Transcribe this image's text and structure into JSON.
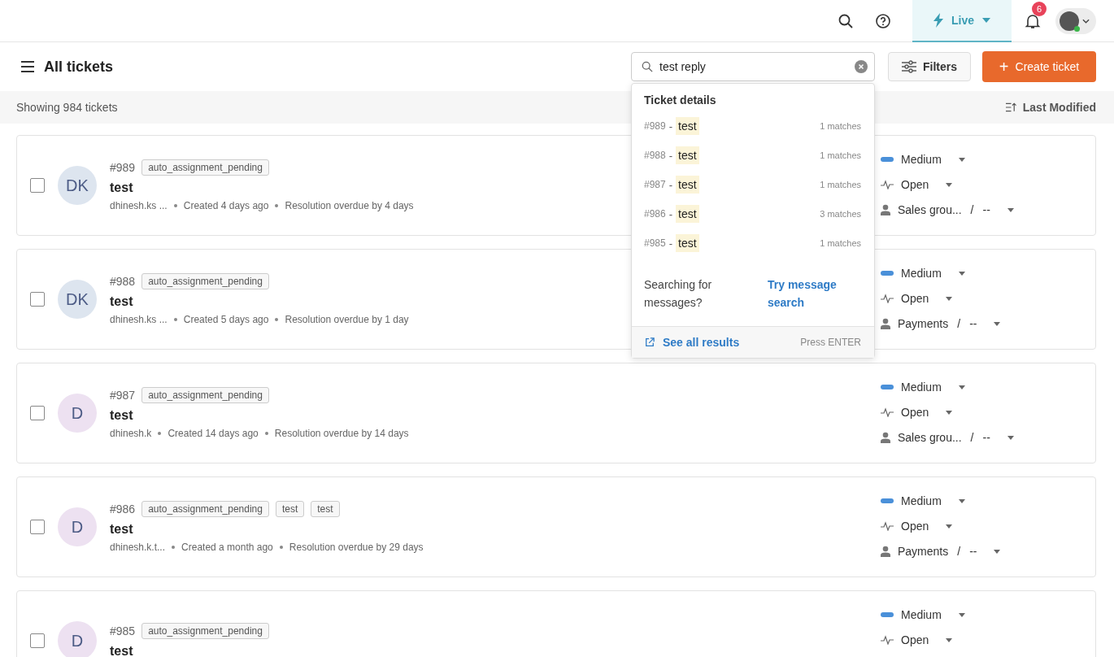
{
  "topbar": {
    "live_label": "Live",
    "notification_count": "6"
  },
  "header": {
    "title": "All tickets",
    "search": {
      "value": "test reply"
    },
    "filters_label": "Filters",
    "create_label": "Create ticket",
    "create_icon": "+"
  },
  "subbar": {
    "count": "Showing 984 tickets",
    "sort_label": "Last Modified"
  },
  "tickets": [
    {
      "id": "#989",
      "tags": [
        "auto_assignment_pending"
      ],
      "subject": "test",
      "initials": "DK",
      "color": "#dde5ef",
      "meta": [
        "dhinesh.ks ...",
        "Created 4 days ago",
        "Resolution overdue by 4 days"
      ],
      "priority": "Medium",
      "status": "Open",
      "team": "Sales grou...",
      "separator": "/",
      "agent": "--",
      "checked": false
    },
    {
      "id": "#988",
      "tags": [
        "auto_assignment_pending"
      ],
      "subject": "test",
      "initials": "DK",
      "color": "#dde5ef",
      "meta": [
        "dhinesh.ks ...",
        "Created 5 days ago",
        "Resolution overdue by 1 day"
      ],
      "priority": "Medium",
      "status": "Open",
      "team": "Payments",
      "separator": "/",
      "agent": "--",
      "checked": false
    },
    {
      "id": "#987",
      "tags": [
        "auto_assignment_pending"
      ],
      "subject": "test",
      "initials": "D",
      "color": "#ede1f1",
      "meta": [
        "dhinesh.k",
        "Created 14 days ago",
        "Resolution overdue by 14 days"
      ],
      "priority": "Medium",
      "status": "Open",
      "team": "Sales grou...",
      "separator": "/",
      "agent": "--",
      "checked": false
    },
    {
      "id": "#986",
      "tags": [
        "auto_assignment_pending",
        "test",
        "test"
      ],
      "subject": "test",
      "initials": "D",
      "color": "#ede1f1",
      "meta": [
        "dhinesh.k.t...",
        "Created a month ago",
        "Resolution overdue by 29 days"
      ],
      "priority": "Medium",
      "status": "Open",
      "team": "Payments",
      "separator": "/",
      "agent": "--",
      "checked": false
    },
    {
      "id": "#985",
      "tags": [
        "auto_assignment_pending"
      ],
      "subject": "test",
      "initials": "D",
      "color": "#ede1f1",
      "priority": "Medium",
      "status": "Open",
      "checked": false
    }
  ],
  "search_dropdown": {
    "heading": "Ticket details",
    "results": [
      {
        "id": "#989",
        "separator": "-",
        "subject": "test",
        "matches": "1 matches"
      },
      {
        "id": "#988",
        "separator": "-",
        "subject": "test",
        "matches": "1 matches"
      },
      {
        "id": "#987",
        "separator": "-",
        "subject": "test",
        "matches": "1 matches"
      },
      {
        "id": "#986",
        "separator": "-",
        "subject": "test",
        "matches": "3 matches"
      },
      {
        "id": "#985",
        "separator": "-",
        "subject": "test",
        "matches": "1 matches"
      }
    ],
    "hint": "Searching for messages?",
    "hint_link": "Try message search",
    "see_all": "See all results",
    "shortcut": "Press ENTER"
  }
}
